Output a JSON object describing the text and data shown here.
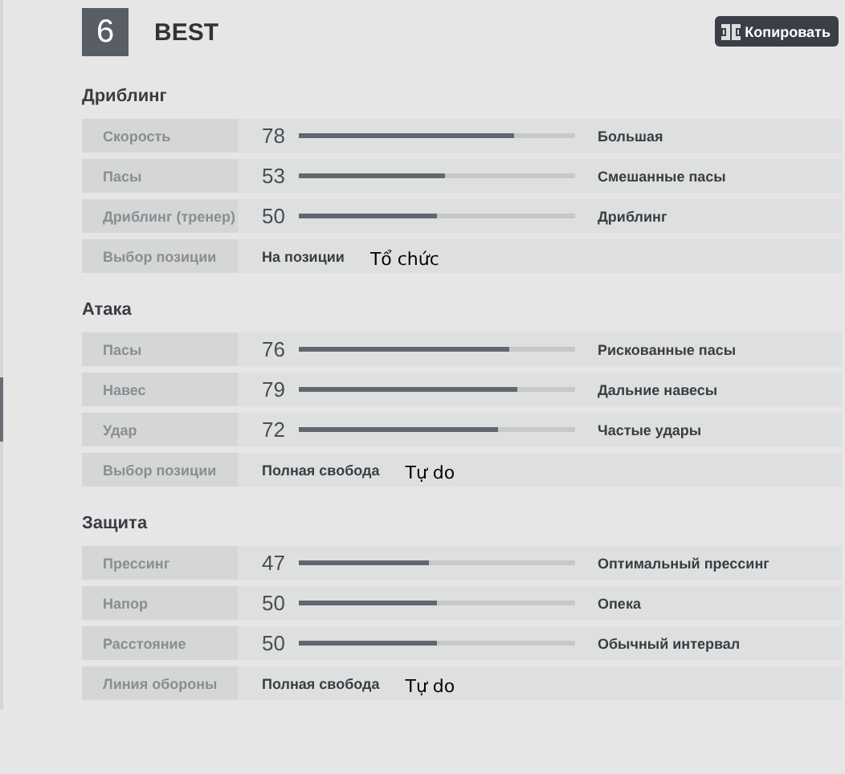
{
  "header": {
    "number": "6",
    "title": "BEST",
    "copy_button": "Копировать"
  },
  "sections": [
    {
      "title": "Дриблинг",
      "rows": [
        {
          "kind": "slider",
          "label": "Скорость",
          "value": "78",
          "level": 0.78,
          "setting": "Большая"
        },
        {
          "kind": "slider",
          "label": "Пасы",
          "value": "53",
          "level": 0.53,
          "setting": "Смешанные пасы"
        },
        {
          "kind": "slider",
          "label": "Дриблинг (тренер)",
          "value": "50",
          "level": 0.5,
          "setting": "Дриблинг"
        },
        {
          "kind": "choice",
          "label": "Выбор позиции",
          "setting": "На позиции",
          "note": "Tổ chức"
        }
      ]
    },
    {
      "title": "Атака",
      "rows": [
        {
          "kind": "slider",
          "label": "Пасы",
          "value": "76",
          "level": 0.76,
          "setting": "Рискованные пасы"
        },
        {
          "kind": "slider",
          "label": "Навес",
          "value": "79",
          "level": 0.79,
          "setting": "Дальние навесы"
        },
        {
          "kind": "slider",
          "label": "Удар",
          "value": "72",
          "level": 0.72,
          "setting": "Частые удары"
        },
        {
          "kind": "choice",
          "label": "Выбор позиции",
          "setting": "Полная свобода",
          "note": "Tự do"
        }
      ]
    },
    {
      "title": "Защита",
      "rows": [
        {
          "kind": "slider",
          "label": "Прессинг",
          "value": "47",
          "level": 0.47,
          "setting": "Оптимальный прессинг"
        },
        {
          "kind": "slider",
          "label": "Напор",
          "value": "50",
          "level": 0.5,
          "setting": "Опека"
        },
        {
          "kind": "slider",
          "label": "Расстояние",
          "value": "50",
          "level": 0.5,
          "setting": "Обычный интервал"
        },
        {
          "kind": "choice",
          "label": "Линия обороны",
          "setting": "Полная свобода",
          "note": "Tự do"
        }
      ]
    }
  ]
}
